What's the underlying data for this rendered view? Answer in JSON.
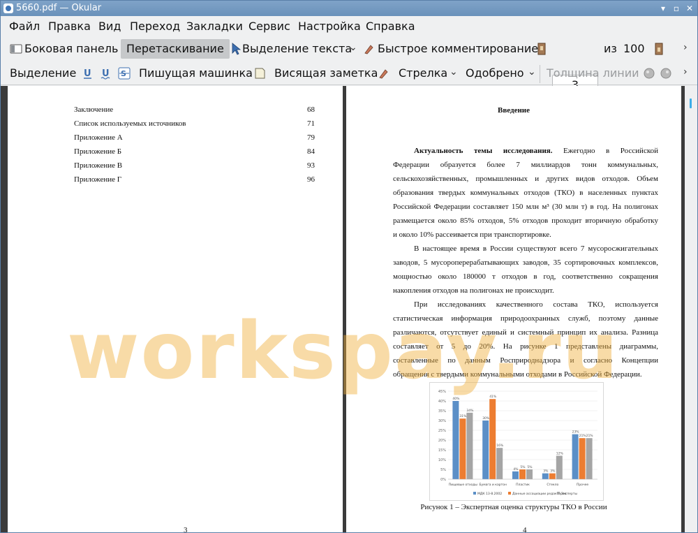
{
  "window": {
    "title": "5660.pdf  — Okular"
  },
  "menu": [
    "Файл",
    "Правка",
    "Вид",
    "Переход",
    "Закладки",
    "Сервис",
    "Настройка",
    "Справка"
  ],
  "toolbar1": {
    "sidebar": "Боковая панель",
    "drag": "Перетаскивание",
    "text_select": "Выделение текста",
    "quick_comment": "Быстрое комментирование",
    "page_current": "3",
    "page_of": "из",
    "page_total": "100"
  },
  "toolbar2": {
    "selection": "Выделение",
    "typewriter": "Пишущая машинка",
    "sticky_note": "Висящая заметка",
    "arrow": "Стрелка",
    "approved": "Одобрено",
    "line_width": "Толщина линии"
  },
  "left_page": {
    "toc": [
      {
        "label": "Заключение",
        "page": "68"
      },
      {
        "label": "Список используемых источников",
        "page": "71"
      },
      {
        "label": "Приложение А",
        "page": "79"
      },
      {
        "label": "Приложение Б",
        "page": "84"
      },
      {
        "label": "Приложение В",
        "page": "93"
      },
      {
        "label": "Приложение Г",
        "page": "96"
      }
    ],
    "page_number": "3"
  },
  "right_page": {
    "heading": "Введение",
    "lines": [
      "Актуальность темы исследования. Ежегодно в Российской",
      "Федерации образуется более 7 миллиардов тонн коммунальных,",
      "сельскохозяйственных, промышленных и других видов отходов. Объем",
      "образования твердых коммунальных отходов (ТКО) в населенных пунктах",
      "Российской Федерации составляет 150 млн м³ (30 млн т) в год. На полигонах",
      "размещается около 85% отходов, 5% отходов проходит вторичную обработку",
      "и около 10% рассеивается при транспортировке.",
      "В настоящее время в России существуют всего 7 мусоросжигательных",
      "заводов, 5 мусороперерабатывающих заводов, 35 сортировочных комплексов,",
      "мощностью около 180000 т отходов в год, соответственно сокращения",
      "накопления отходов на полигонах не происходит.",
      "При исследованиях качественного состава ТКО, используется",
      "статистическая информация природоохранных служб, поэтому данные",
      "различаются, отсутствует единый и системный принцип их анализа. Разница",
      "составляет от 5 до 20%. На рисунке 1 представлены диаграммы,",
      "составленные по данным Росприроднадзора и согласно Концепции",
      "обращения с твердыми коммунальными отходами в Российской Федерации."
    ],
    "figure_caption": "Рисунок 1 – Экспертная оценка структуры ТКО в России",
    "page_number": "4"
  },
  "watermark": "workspay.ru",
  "colors": {
    "titlebar": "#6a91ba",
    "accent": "#3daee9",
    "series1": "#5b8fc7",
    "series2": "#ed7d31",
    "series3": "#a5a5a5"
  },
  "chart_data": {
    "type": "bar",
    "categories": [
      "Пищевые отходы",
      "Бумага и картон",
      "Пластик",
      "Стекло",
      "Прочее"
    ],
    "series": [
      {
        "name": "МДК 13-8.2002",
        "values": [
          40,
          30,
          4,
          3,
          23
        ]
      },
      {
        "name": "Данные ассоциации редакторов",
        "values": [
          31,
          41,
          5,
          3,
          21
        ]
      },
      {
        "name": "Эксперты",
        "values": [
          34,
          16,
          5,
          12,
          21
        ]
      }
    ],
    "value_labels": [
      [
        "40%",
        "30%",
        "4%",
        "3%",
        "23%"
      ],
      [
        "31%",
        "41%",
        "5%",
        "3%",
        "21%"
      ],
      [
        "34%",
        "16%",
        "5%",
        "12%",
        "21%"
      ]
    ],
    "y_ticks": [
      "0%",
      "5%",
      "10%",
      "15%",
      "20%",
      "25%",
      "30%",
      "35%",
      "40%",
      "45%"
    ],
    "ylim": [
      0,
      45
    ],
    "legend_position": "bottom",
    "grid": true
  }
}
